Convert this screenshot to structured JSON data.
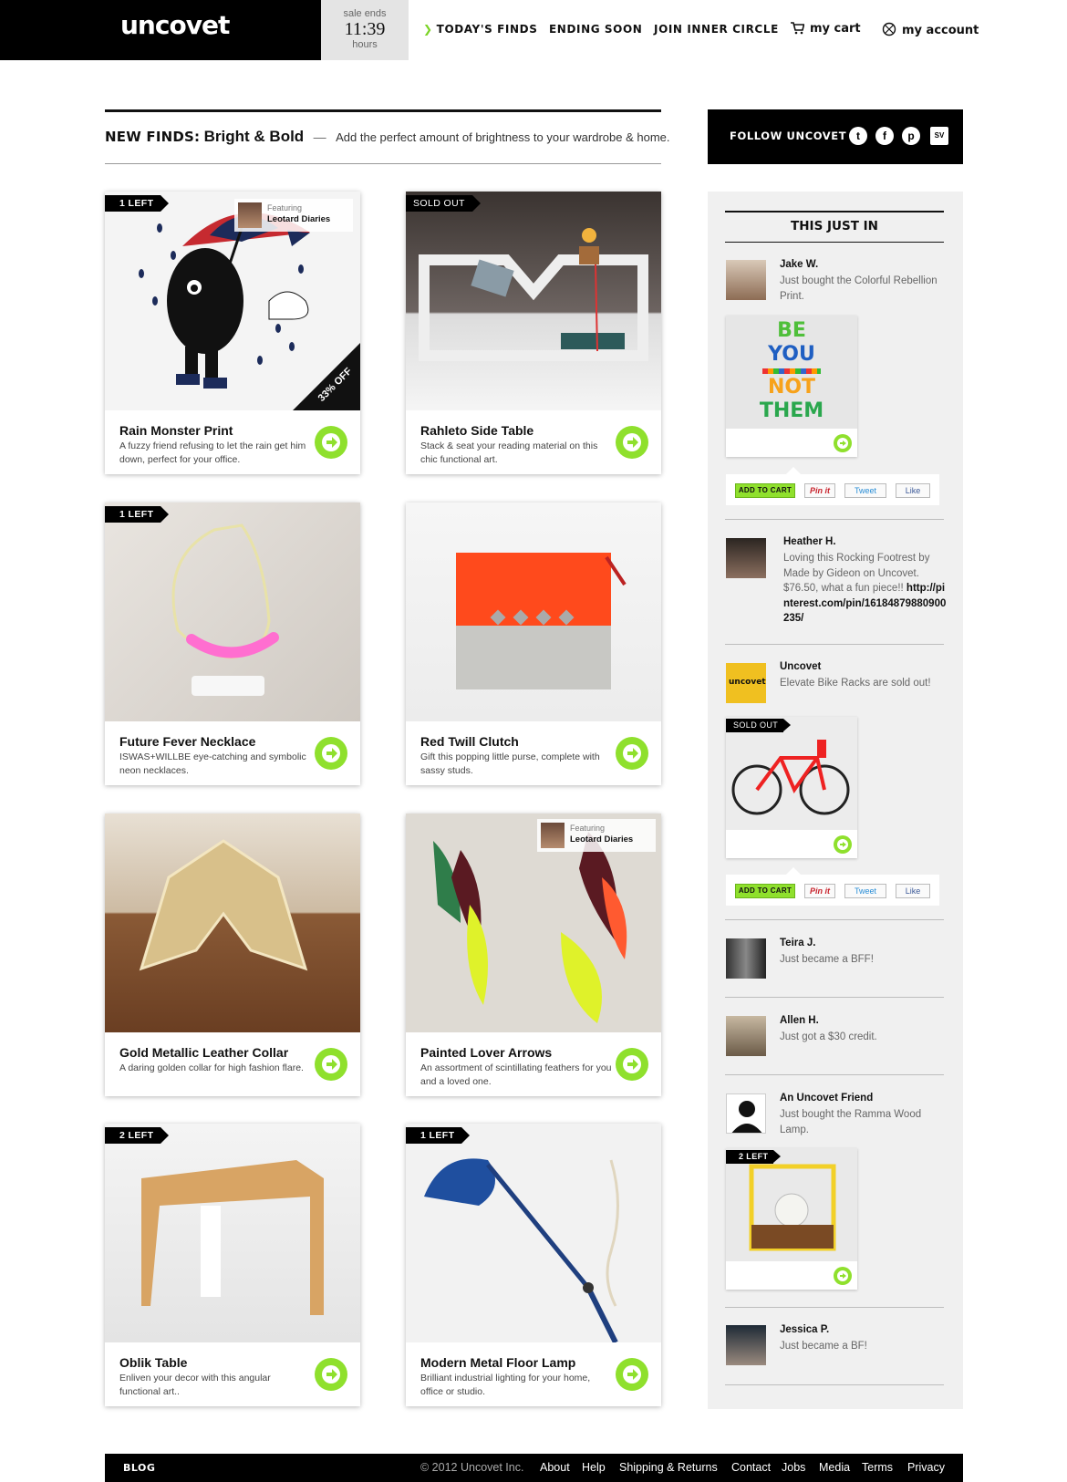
{
  "header": {
    "logo": "uncovet",
    "sale": {
      "label": "sale ends",
      "time": "11:39",
      "unit": "hours"
    },
    "nav": {
      "todays_finds": "TODAY'S FINDS",
      "ending_soon": "ENDING SOON",
      "join": "JOIN INNER CIRCLE",
      "cart": "my cart",
      "account": "my account"
    }
  },
  "heading": {
    "prefix": "NEW FINDS:",
    "title": "Bright & Bold",
    "dash": "—",
    "subtitle": "Add the perfect amount of brightness to your wardrobe & home."
  },
  "products": [
    {
      "title": "Rain Monster Print",
      "desc": "A fuzzy friend refusing to let the rain get him down, perfect for your office.",
      "badge": "1 LEFT",
      "discount": "33% OFF",
      "featuring_label": "Featuring",
      "featuring_name": "Leotard Diaries"
    },
    {
      "title": "Rahleto Side Table",
      "desc": "Stack & seat your reading material on this chic functional art.",
      "badge": "SOLD OUT"
    },
    {
      "title": "Future Fever Necklace",
      "desc": "ISWAS+WILLBE eye-catching and symbolic neon necklaces.",
      "badge": "1 LEFT"
    },
    {
      "title": "Red Twill Clutch",
      "desc": "Gift this popping little purse, complete with sassy studs."
    },
    {
      "title": "Gold Metallic Leather Collar",
      "desc": "A daring golden collar for high fashion flare."
    },
    {
      "title": "Painted Lover Arrows",
      "desc": "An assortment of scintillating feathers for you and a loved one.",
      "featuring_label": "Featuring",
      "featuring_name": "Leotard Diaries"
    },
    {
      "title": "Oblik Table",
      "desc": "Enliven your decor with this angular functional art..",
      "badge": "2 LEFT"
    },
    {
      "title": "Modern Metal Floor Lamp",
      "desc": "Brilliant industrial lighting for your home, office or studio.",
      "badge": "1 LEFT"
    }
  ],
  "sidebar": {
    "follow_label": "FOLLOW UNCOVET",
    "social": {
      "twitter": "t",
      "facebook": "f",
      "pinterest": "p",
      "sv": "SV"
    },
    "title": "THIS JUST IN",
    "poster_lines": [
      "BE",
      "YOU",
      "NOT",
      "THEM"
    ],
    "share": {
      "cart": "ADD TO CART",
      "pin": "Pin it",
      "tweet": "Tweet",
      "like": "Like"
    },
    "activity": [
      {
        "name": "Jake W.",
        "text": "Just bought the Colorful Rebellion Print."
      },
      {
        "name": "Heather H.",
        "text": "Loving this Rocking Footrest by Made by Gideon on Uncovet. $76.50, what a fun piece!!",
        "link": "http://pinterest.com/pin/16184879880900235/"
      },
      {
        "name": "Uncovet",
        "text": "Elevate Bike Racks are sold out!",
        "avatar_text": "uncovet",
        "badge": "SOLD OUT"
      },
      {
        "name": "Teira J.",
        "text": "Just became a BFF!"
      },
      {
        "name": "Allen H.",
        "text": "Just got a $30 credit."
      },
      {
        "name": "An Uncovet Friend",
        "text": "Just bought the Ramma Wood Lamp.",
        "badge": "2 LEFT"
      },
      {
        "name": "Jessica P.",
        "text": "Just became a BF!"
      }
    ]
  },
  "footer": {
    "blog": "BLOG",
    "copyright": "© 2012 Uncovet Inc.",
    "links": [
      "About",
      "Help",
      "Shipping & Returns",
      "Contact",
      "Jobs",
      "Media",
      "Terms",
      "Privacy"
    ]
  },
  "colors": {
    "accent_green": "#8fe02d",
    "black": "#000000",
    "panel_gray": "#f0f0f0"
  }
}
